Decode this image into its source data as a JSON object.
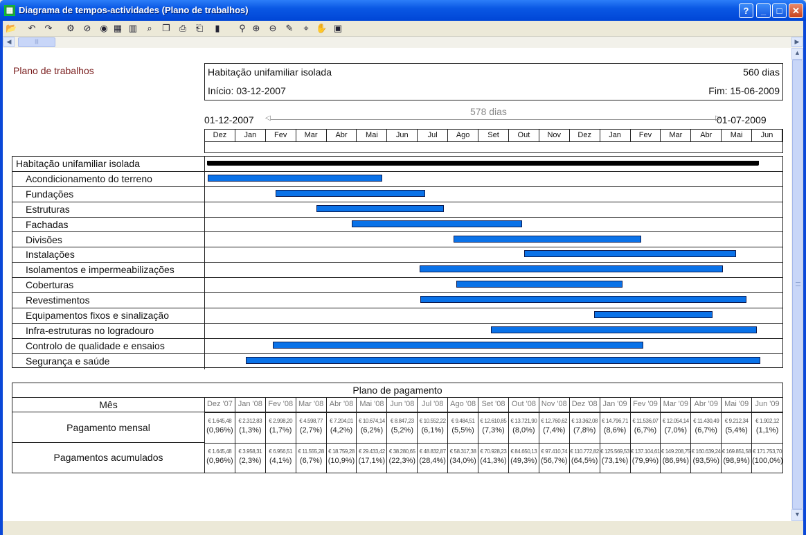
{
  "window": {
    "title": "Diagrama de tempos-actividades (Plano de trabalhos)",
    "help": "?",
    "minimize": "_",
    "maximize": "□",
    "close": "✕"
  },
  "toolbar": {
    "icons": [
      "open-folder-icon",
      "undo-icon",
      "redo-icon",
      "settings-icon",
      "stop-record-icon",
      "record-icon",
      "chart-image-icon",
      "bar-chart-icon",
      "page-zoom-icon",
      "copy-icon",
      "print-icon",
      "print-setup-icon",
      "histogram-icon",
      "select-zoom-icon",
      "zoom-in-icon",
      "zoom-out-icon",
      "pencil-icon",
      "zoom-area-icon",
      "hand-icon",
      "window-icon"
    ]
  },
  "plan": {
    "label": "Plano de trabalhos",
    "project": "Habitação unifamiliar isolada",
    "duration": "560 dias",
    "start": "Início: 03-12-2007",
    "end": "Fim: 15-06-2009",
    "range_start": "01-12-2007",
    "range_end": "01-07-2009",
    "range_days": "578 dias",
    "months": [
      "Dez",
      "Jan",
      "Fev",
      "Mar",
      "Abr",
      "Mai",
      "Jun",
      "Jul",
      "Ago",
      "Set",
      "Out",
      "Nov",
      "Dez",
      "Jan",
      "Fev",
      "Mar",
      "Abr",
      "Mai",
      "Jun"
    ]
  },
  "tasks": [
    {
      "name": "Habitação unifamiliar isolada",
      "start": 0.0,
      "end": 18.47,
      "summary": true
    },
    {
      "name": "Acondicionamento do terreno",
      "start": 0.03,
      "end": 5.87
    },
    {
      "name": "Fundações",
      "start": 2.3,
      "end": 7.3
    },
    {
      "name": "Estruturas",
      "start": 3.65,
      "end": 7.92
    },
    {
      "name": "Fachadas",
      "start": 4.85,
      "end": 10.53
    },
    {
      "name": "Divisões",
      "start": 8.25,
      "end": 14.53
    },
    {
      "name": "Instalações",
      "start": 10.6,
      "end": 17.7
    },
    {
      "name": "Isolamentos e impermeabilizações",
      "start": 7.1,
      "end": 17.25
    },
    {
      "name": "Coberturas",
      "start": 8.33,
      "end": 13.9
    },
    {
      "name": "Revestimentos",
      "start": 7.13,
      "end": 18.05
    },
    {
      "name": "Equipamentos fixos e sinalização",
      "start": 12.95,
      "end": 16.9
    },
    {
      "name": "Infra-estruturas no logradouro",
      "start": 9.5,
      "end": 18.4
    },
    {
      "name": "Controlo de qualidade e ensaios",
      "start": 2.2,
      "end": 14.6
    },
    {
      "name": "Segurança e saúde",
      "start": 1.3,
      "end": 18.5
    }
  ],
  "payment": {
    "title": "Plano de pagamento",
    "month_header": "Mês",
    "monthly_label": "Pagamento mensal",
    "cumulative_label": "Pagamentos acumulados",
    "months": [
      "Dez '07",
      "Jan '08",
      "Fev '08",
      "Mar '08",
      "Abr '08",
      "Mai '08",
      "Jun '08",
      "Jul '08",
      "Ago '08",
      "Set '08",
      "Out '08",
      "Nov '08",
      "Dez '08",
      "Jan '09",
      "Fev '09",
      "Mar '09",
      "Abr '09",
      "Mai '09",
      "Jun '09"
    ],
    "monthly": [
      [
        "€ 1.645,48",
        "(0,96%)"
      ],
      [
        "€ 2.312,83",
        "(1,3%)"
      ],
      [
        "€ 2.998,20",
        "(1,7%)"
      ],
      [
        "€ 4.598,77",
        "(2,7%)"
      ],
      [
        "€ 7.204,01",
        "(4,2%)"
      ],
      [
        "€ 10.674,14",
        "(6,2%)"
      ],
      [
        "€ 8.847,23",
        "(5,2%)"
      ],
      [
        "€ 10.552,22",
        "(6,1%)"
      ],
      [
        "€ 9.484,51",
        "(5,5%)"
      ],
      [
        "€ 12.610,85",
        "(7,3%)"
      ],
      [
        "€ 13.721,90",
        "(8,0%)"
      ],
      [
        "€ 12.760,62",
        "(7,4%)"
      ],
      [
        "€ 13.362,08",
        "(7,8%)"
      ],
      [
        "€ 14.796,71",
        "(8,6%)"
      ],
      [
        "€ 11.536,07",
        "(6,7%)"
      ],
      [
        "€ 12.054,14",
        "(7,0%)"
      ],
      [
        "€ 11.430,49",
        "(6,7%)"
      ],
      [
        "€ 9.212,34",
        "(5,4%)"
      ],
      [
        "€ 1.902,12",
        "(1,1%)"
      ]
    ],
    "cumulative": [
      [
        "€ 1.645,48",
        "(0,96%)"
      ],
      [
        "€ 3.958,31",
        "(2,3%)"
      ],
      [
        "€ 6.956,51",
        "(4,1%)"
      ],
      [
        "€ 11.555,28",
        "(6,7%)"
      ],
      [
        "€ 18.759,28",
        "(10,9%)"
      ],
      [
        "€ 29.433,42",
        "(17,1%)"
      ],
      [
        "€ 38.280,65",
        "(22,3%)"
      ],
      [
        "€ 48.832,87",
        "(28,4%)"
      ],
      [
        "€ 58.317,38",
        "(34,0%)"
      ],
      [
        "€ 70.928,23",
        "(41,3%)"
      ],
      [
        "€ 84.650,13",
        "(49,3%)"
      ],
      [
        "€ 97.410,74",
        "(56,7%)"
      ],
      [
        "€ 110.772,82",
        "(64,5%)"
      ],
      [
        "€ 125.569,53",
        "(73,1%)"
      ],
      [
        "€ 137.104,61",
        "(79,9%)"
      ],
      [
        "€ 149.208,75",
        "(86,9%)"
      ],
      [
        "€ 160.639,24",
        "(93,5%)"
      ],
      [
        "€ 169.851,58",
        "(98,9%)"
      ],
      [
        "€ 171.753,70",
        "(100,0%)"
      ]
    ]
  }
}
